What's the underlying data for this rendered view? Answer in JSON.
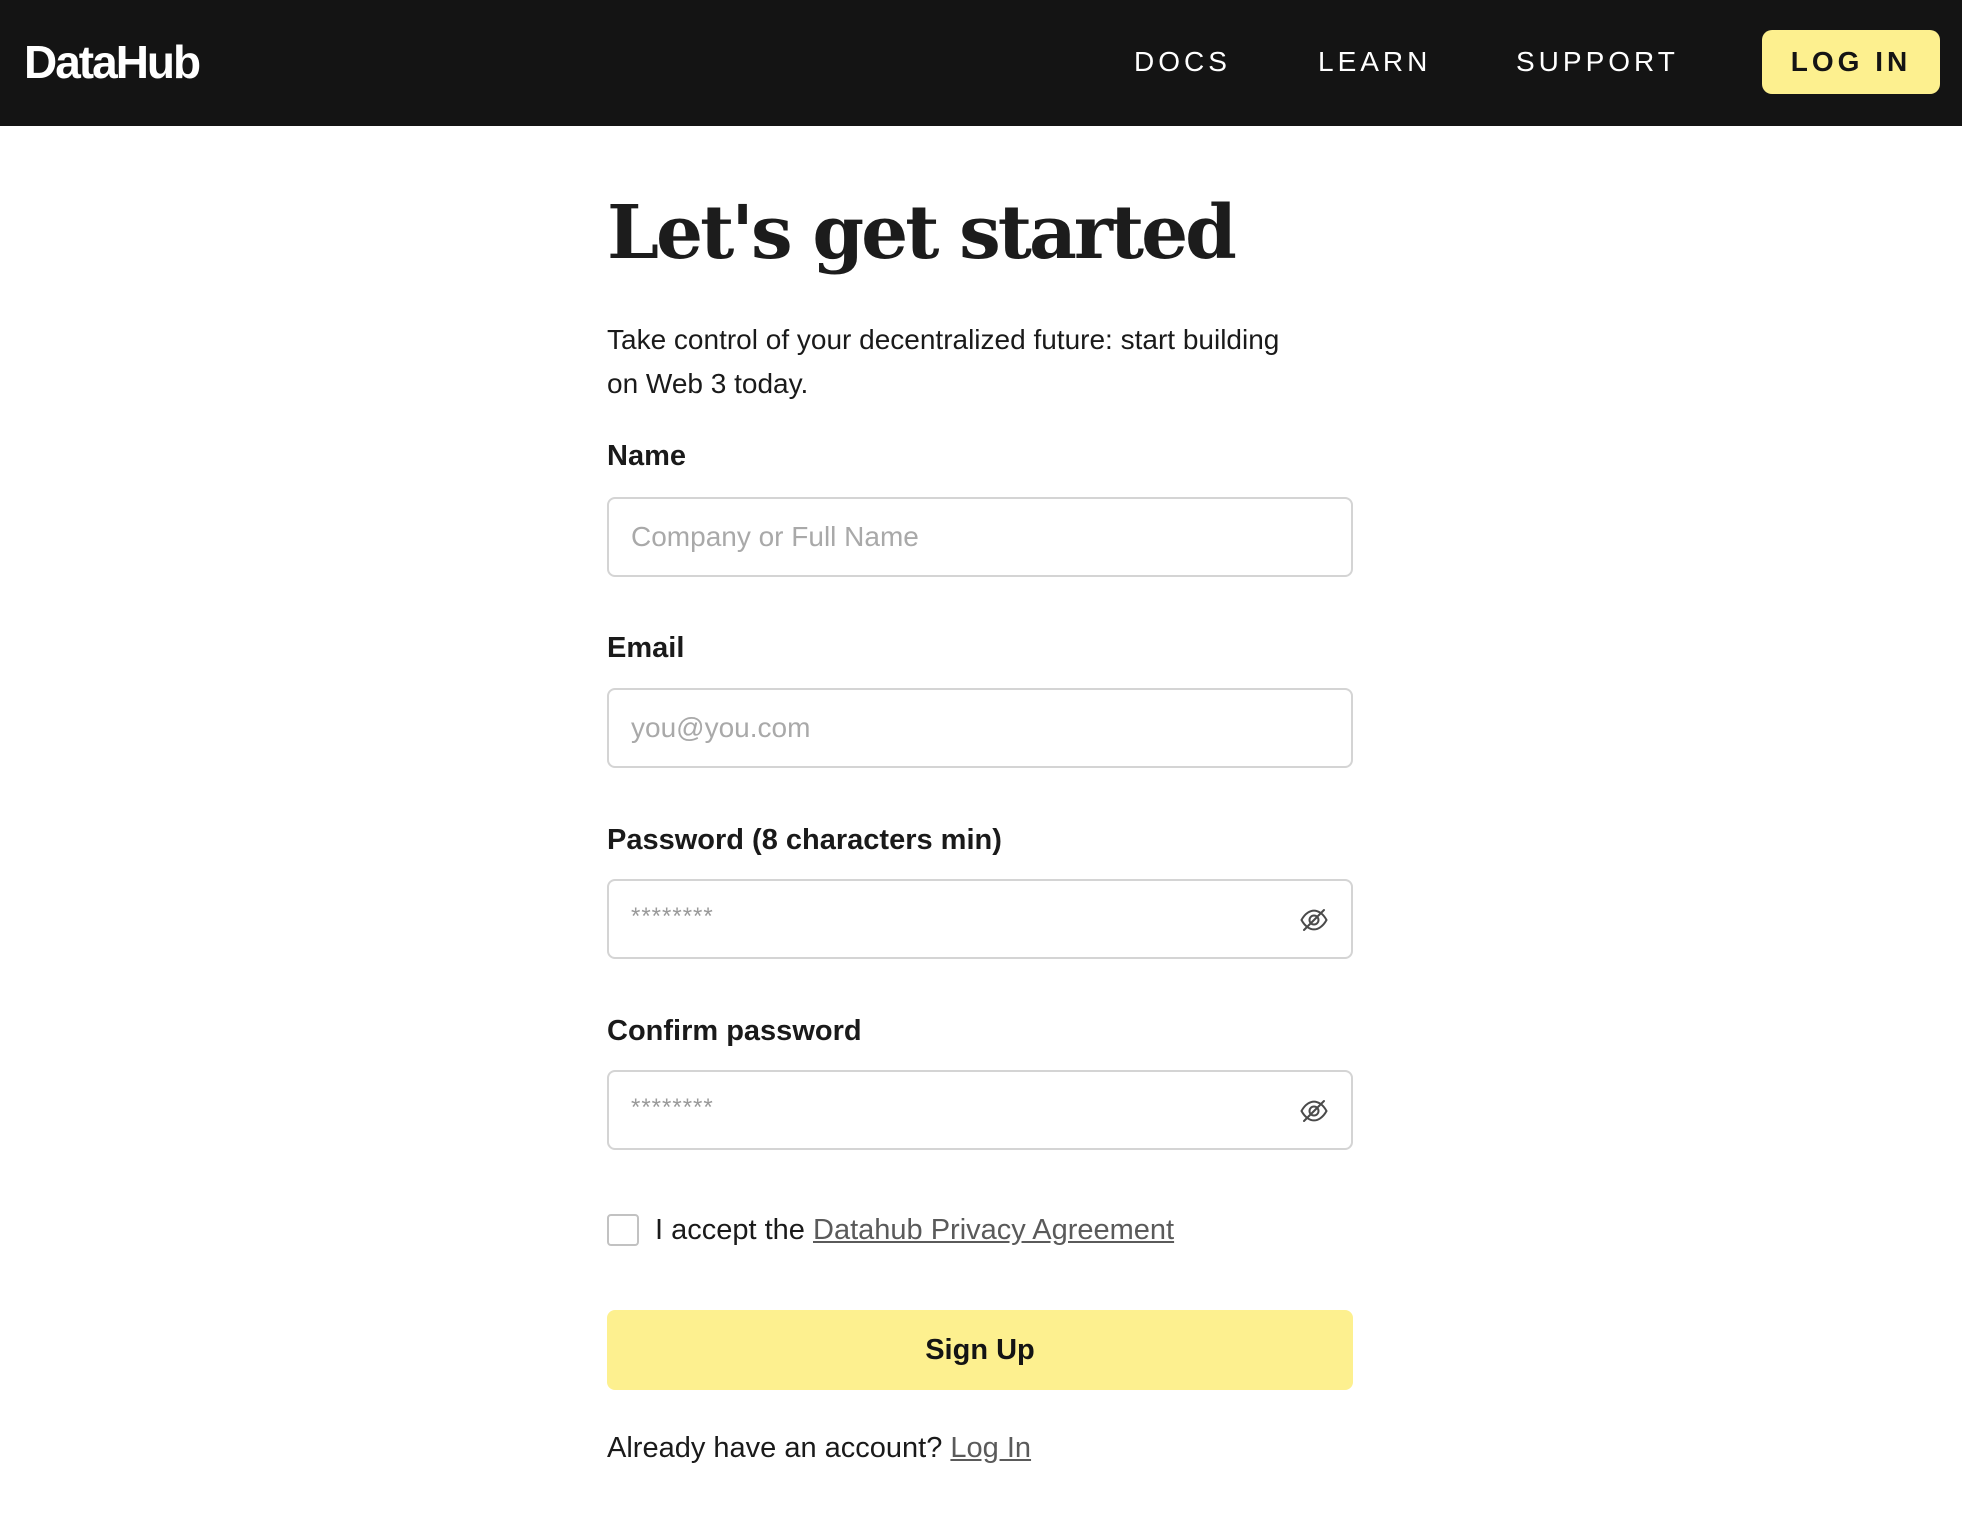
{
  "header": {
    "logo_text": "DataHub",
    "nav": {
      "docs": "DOCS",
      "learn": "LEARN",
      "support": "SUPPORT"
    },
    "login_label": "LOG IN",
    "accent_color": "#fdf08f",
    "background_color": "#141414"
  },
  "form": {
    "title": "Let's get started",
    "subtitle_line1": "Take control of your decentralized future: start building",
    "subtitle_line2": "on Web 3 today.",
    "name": {
      "label": "Name",
      "placeholder": "Company or Full Name",
      "value": ""
    },
    "email": {
      "label": "Email",
      "placeholder": "you@you.com",
      "value": ""
    },
    "password": {
      "label": "Password (8 characters min)",
      "placeholder": "********",
      "visibility_icon": "eye-slash-icon"
    },
    "confirm_password": {
      "label": "Confirm password",
      "placeholder": "********",
      "visibility_icon": "eye-slash-icon"
    },
    "agreement": {
      "checked": false,
      "prefix": "I accept the",
      "link_text": "Datahub Privacy Agreement"
    },
    "submit_label": "Sign Up",
    "footer": {
      "prefix": "Already have an account?",
      "link_text": "Log In"
    }
  }
}
